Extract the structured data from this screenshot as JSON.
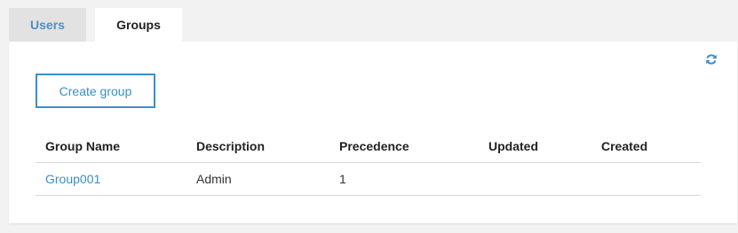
{
  "tabs": [
    {
      "label": "Users",
      "active": false
    },
    {
      "label": "Groups",
      "active": true
    }
  ],
  "toolbar": {
    "refresh_icon": "refresh-icon",
    "create_label": "Create group"
  },
  "table": {
    "columns": [
      "Group Name",
      "Description",
      "Precedence",
      "Updated",
      "Created"
    ],
    "rows": [
      {
        "name": "Group001",
        "description": "Admin",
        "precedence": "1",
        "updated": "",
        "created": ""
      }
    ]
  },
  "colors": {
    "accent": "#3a8fcb",
    "inactive_tab_bg": "#e2e2e2",
    "page_bg": "#f2f2f2"
  }
}
